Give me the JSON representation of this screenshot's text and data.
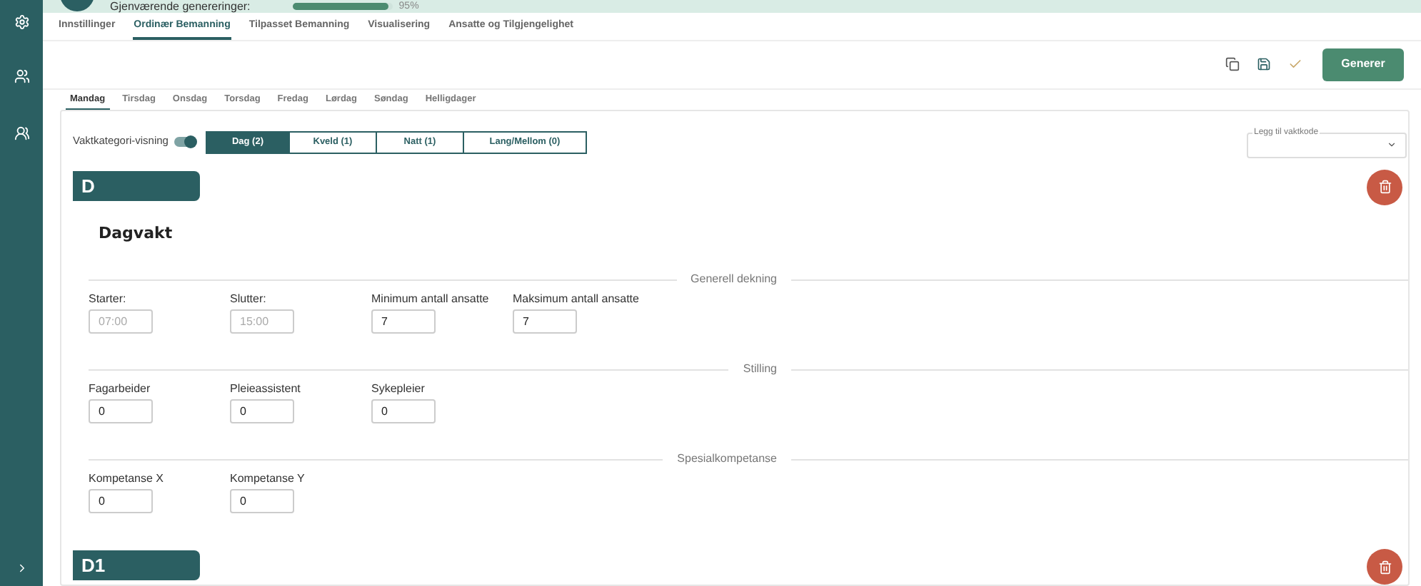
{
  "header": {
    "remaining_label": "Gjenværende genereringer:",
    "level": 0.95,
    "reading": "95%"
  },
  "tabs": [
    {
      "label": "Innstillinger",
      "selected": false
    },
    {
      "label": "Ordinær Bemanning",
      "selected": true
    },
    {
      "label": "Tilpasset Bemanning",
      "selected": false
    },
    {
      "label": "Visualisering",
      "selected": false
    },
    {
      "label": "Ansatte og Tilgjengelighet",
      "selected": false
    }
  ],
  "toolbar": {
    "generate_button": "Generer"
  },
  "day_tabs": [
    {
      "label": "Mandag",
      "selected": true
    },
    {
      "label": "Tirsdag",
      "selected": false
    },
    {
      "label": "Onsdag",
      "selected": false
    },
    {
      "label": "Torsdag",
      "selected": false
    },
    {
      "label": "Fredag",
      "selected": false
    },
    {
      "label": "Lørdag",
      "selected": false
    },
    {
      "label": "Søndag",
      "selected": false
    },
    {
      "label": "Helligdager",
      "selected": false
    }
  ],
  "view_toggle": {
    "label": "Vaktkategori-visning",
    "on": true
  },
  "categories": [
    {
      "label": "Dag (2)",
      "selected": true
    },
    {
      "label": "Kveld (1)",
      "selected": false
    },
    {
      "label": "Natt (1)",
      "selected": false
    },
    {
      "label": "Lang/Mellom (0)",
      "selected": false
    }
  ],
  "shift_code_select": {
    "label": "Legg til vaktkode"
  },
  "shifts": [
    {
      "code": "D",
      "name": "Dagvakt",
      "sections": [
        {
          "title": "Generell dekning",
          "fields": [
            {
              "label": "Starter:",
              "value": "07:00",
              "disabled": true
            },
            {
              "label": "Slutter:",
              "value": "15:00",
              "disabled": true
            },
            {
              "label": "Minimum antall ansatte",
              "value": "7",
              "disabled": false
            },
            {
              "label": "Maksimum antall ansatte",
              "value": "7",
              "disabled": false
            }
          ]
        },
        {
          "title": "Stilling",
          "fields": [
            {
              "label": "Fagarbeider",
              "value": "0",
              "disabled": false
            },
            {
              "label": "Pleieassistent",
              "value": "0",
              "disabled": false
            },
            {
              "label": "Sykepleier",
              "value": "0",
              "disabled": false
            }
          ]
        },
        {
          "title": "Spesialkompetanse",
          "fields": [
            {
              "label": "Kompetanse X",
              "value": "0",
              "disabled": false
            },
            {
              "label": "Kompetanse Y",
              "value": "0",
              "disabled": false
            }
          ]
        }
      ]
    },
    {
      "code": "D1"
    }
  ]
}
